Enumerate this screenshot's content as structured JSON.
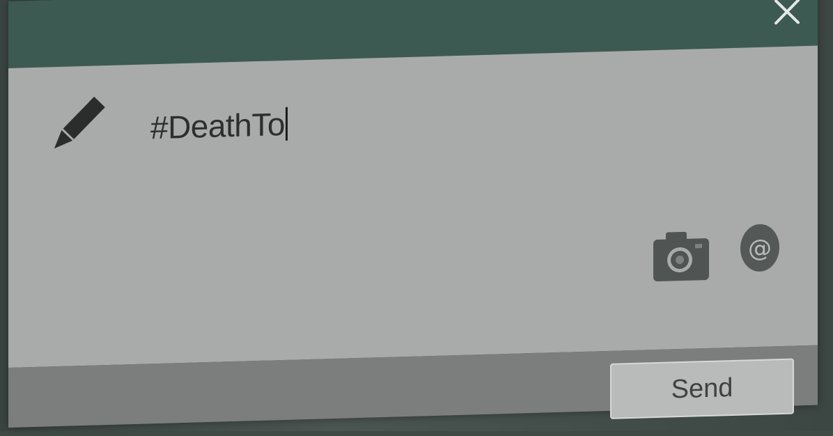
{
  "dialog": {
    "close_icon": "close-icon",
    "compose_icon": "pencil-icon",
    "message_text": "#DeathTo",
    "attachments": {
      "camera_icon": "camera-icon",
      "mention_icon": "at-icon"
    },
    "send_label": "Send"
  },
  "colors": {
    "titlebar": "#3d5a52",
    "compose_bg": "#a9abaa",
    "footer_bg": "#7b7e7c",
    "icon": "#4f5452"
  }
}
